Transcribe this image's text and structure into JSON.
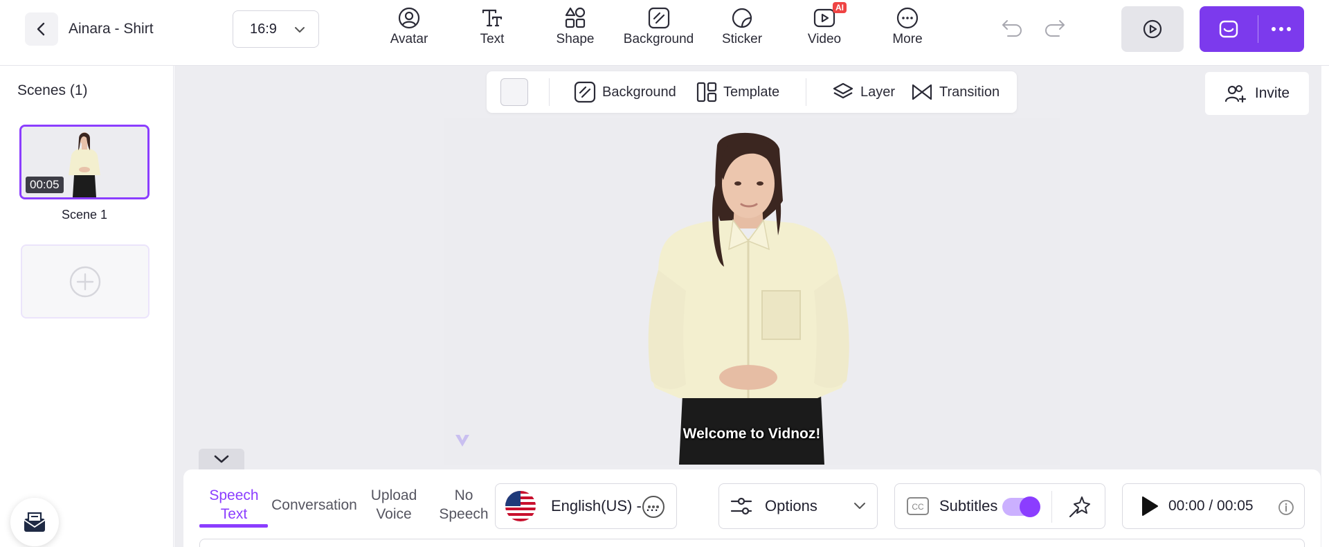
{
  "header": {
    "project_title": "Ainara - Shirt",
    "aspect_ratio": "16:9",
    "tools": [
      {
        "label": "Avatar",
        "icon": "avatar-icon"
      },
      {
        "label": "Text",
        "icon": "text-icon"
      },
      {
        "label": "Shape",
        "icon": "shape-icon"
      },
      {
        "label": "Background",
        "icon": "background-icon"
      },
      {
        "label": "Sticker",
        "icon": "sticker-icon"
      },
      {
        "label": "Video",
        "icon": "video-icon",
        "badge": "AI"
      },
      {
        "label": "More",
        "icon": "more-icon"
      }
    ],
    "accent_color": "#7c3aed"
  },
  "scenes": {
    "title": "Scenes (1)",
    "items": [
      {
        "label": "Scene 1",
        "duration": "00:05"
      }
    ]
  },
  "canvas_toolbar": {
    "items": [
      {
        "label": "Background",
        "icon": "background-icon"
      },
      {
        "label": "Template",
        "icon": "template-icon"
      },
      {
        "label": "Layer",
        "icon": "layers-icon"
      },
      {
        "label": "Transition",
        "icon": "transition-icon"
      }
    ]
  },
  "invite": {
    "label": "Invite"
  },
  "stage": {
    "subtitle": "Welcome to Vidnoz!"
  },
  "bottom": {
    "tabs": [
      {
        "line1": "Speech",
        "line2": "Text",
        "active": true
      },
      {
        "line1": "Conversation",
        "line2": "",
        "active": false
      },
      {
        "line1": "Upload",
        "line2": "Voice",
        "active": false
      },
      {
        "line1": "No",
        "line2": "Speech",
        "active": false
      }
    ],
    "voice_language": "English(US) - ...",
    "options_label": "Options",
    "subtitles_label": "Subtitles",
    "subtitles_enabled": true,
    "playback_time": "00:00 / 00:05"
  }
}
